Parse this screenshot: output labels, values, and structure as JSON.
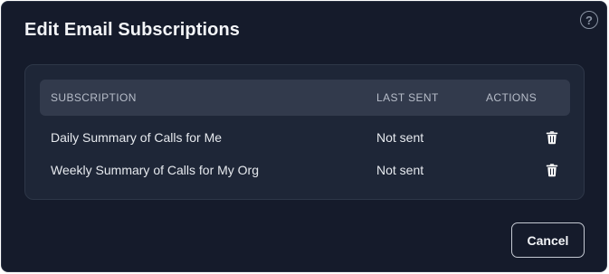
{
  "dialog": {
    "title": "Edit Email Subscriptions",
    "help_icon": "?",
    "cancel_label": "Cancel"
  },
  "table": {
    "columns": [
      "SUBSCRIPTION",
      "LAST SENT",
      "ACTIONS"
    ],
    "rows": [
      {
        "subscription": "Daily Summary of Calls for Me",
        "last_sent": "Not sent",
        "action_icon": "trash-icon"
      },
      {
        "subscription": "Weekly Summary of Calls for My Org",
        "last_sent": "Not sent",
        "action_icon": "trash-icon"
      }
    ]
  },
  "colors": {
    "modal_background": "#151b2b",
    "card_background": "#1e2637",
    "header_background": "#323a4c",
    "text": "#e6e9ee"
  }
}
